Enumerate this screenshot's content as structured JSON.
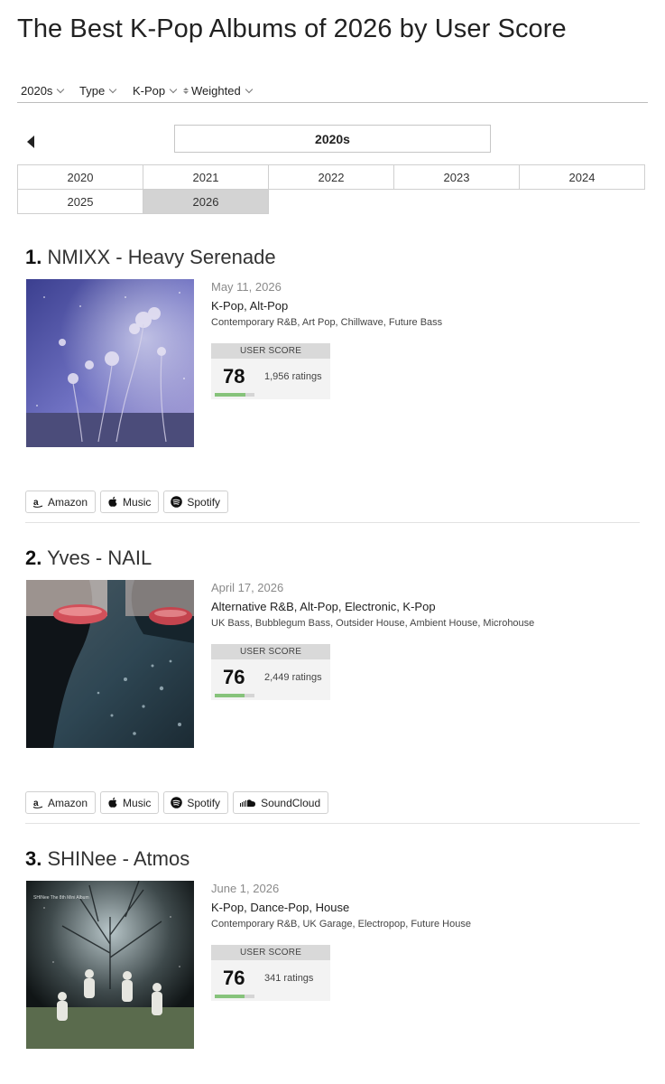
{
  "page": {
    "title": "The Best K-Pop Albums of 2026 by User Score"
  },
  "filters": {
    "decade": "2020s",
    "type": "Type",
    "genre": "K-Pop",
    "sort": "Weighted"
  },
  "decade_nav": {
    "current": "2020s"
  },
  "years": [
    "2020",
    "2021",
    "2022",
    "2023",
    "2024",
    "2025",
    "2026"
  ],
  "selected_year": "2026",
  "score_label": "USER SCORE",
  "colors": {
    "score_bar_fill": "#86c37b",
    "active_year_bg": "#d3d3d3"
  },
  "albums": [
    {
      "rank": "1.",
      "title": "NMIXX - Heavy Serenade",
      "date": "May 11, 2026",
      "genres": "K-Pop, Alt-Pop",
      "subgenres": "Contemporary R&B, Art Pop, Chillwave, Future Bass",
      "score": "78",
      "score_fraction": 0.78,
      "ratings": "1,956 ratings",
      "cover_text": "",
      "links": [
        "Amazon",
        "Music",
        "Spotify"
      ]
    },
    {
      "rank": "2.",
      "title": "Yves - NAIL",
      "date": "April 17, 2026",
      "genres": "Alternative R&B, Alt-Pop, Electronic, K-Pop",
      "subgenres": "UK Bass, Bubblegum Bass, Outsider House, Ambient House, Microhouse",
      "score": "76",
      "score_fraction": 0.76,
      "ratings": "2,449 ratings",
      "links": [
        "Amazon",
        "Music",
        "Spotify",
        "SoundCloud"
      ]
    },
    {
      "rank": "3.",
      "title": "SHINee - Atmos",
      "date": "June 1, 2026",
      "genres": "K-Pop, Dance-Pop, House",
      "subgenres": "Contemporary R&B, UK Garage, Electropop, Future House",
      "score": "76",
      "score_fraction": 0.76,
      "ratings": "341 ratings",
      "cover_text": "SHINee   The 8th Mini Album"
    }
  ],
  "icons": {
    "amazon": "amazon-icon",
    "music": "apple-icon",
    "spotify": "spotify-icon",
    "soundcloud": "soundcloud-icon",
    "prev": "caret-left-icon"
  }
}
